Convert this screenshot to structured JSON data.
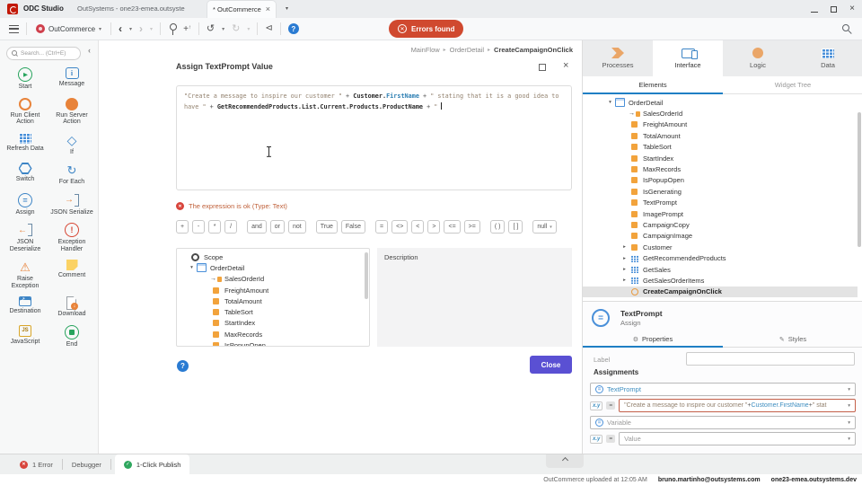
{
  "window": {
    "app_title": "ODC Studio",
    "tab_environment": "OutSystems - one23-emea.outsyste",
    "tab_module": "* OutCommerce"
  },
  "toolbar": {
    "module_name": "OutCommerce",
    "errors_badge": "Errors found"
  },
  "toolbox": {
    "search_placeholder": "Search... (Ctrl+E)",
    "items": [
      {
        "label": "Start",
        "icon": "ic-start",
        "name": "start-icon"
      },
      {
        "label": "Message",
        "icon": "ic-message",
        "name": "message-icon"
      },
      {
        "label": "Run Client Action",
        "icon": "ic-runclient",
        "name": "run-client-action-icon"
      },
      {
        "label": "Run Server Action",
        "icon": "ic-runserver",
        "name": "run-server-action-icon"
      },
      {
        "label": "Refresh Data",
        "icon": "ic-refresh grid-blue",
        "name": "refresh-data-icon"
      },
      {
        "label": "If",
        "icon": "ic-if",
        "name": "if-icon"
      },
      {
        "label": "Switch",
        "icon": "ic-switch",
        "name": "switch-icon"
      },
      {
        "label": "For Each",
        "icon": "ic-foreach",
        "name": "for-each-icon"
      },
      {
        "label": "Assign",
        "icon": "ic-assign",
        "name": "assign-icon"
      },
      {
        "label": "JSON Serialize",
        "icon": "ic-jser",
        "name": "json-serialize-icon"
      },
      {
        "label": "JSON Deserialize",
        "icon": "ic-jdeser",
        "name": "json-deserialize-icon"
      },
      {
        "label": "Exception Handler",
        "icon": "ic-exch",
        "name": "exception-handler-icon"
      },
      {
        "label": "Raise Exception",
        "icon": "ic-raise",
        "name": "raise-exception-icon"
      },
      {
        "label": "Comment",
        "icon": "ic-comment",
        "name": "comment-icon"
      },
      {
        "label": "Destination",
        "icon": "ic-dest",
        "name": "destination-icon"
      },
      {
        "label": "Download",
        "icon": "ic-down",
        "name": "download-icon"
      },
      {
        "label": "JavaScript",
        "icon": "ic-js",
        "name": "javascript-icon"
      },
      {
        "label": "End",
        "icon": "ic-end",
        "name": "end-icon"
      }
    ]
  },
  "canvas": {
    "breadcrumb": [
      "MainFlow",
      "OrderDetail",
      "CreateCampaignOnClick"
    ]
  },
  "dialog": {
    "title": "Assign TextPrompt Value",
    "expression": {
      "segments": [
        {
          "t": "\"Create a message to inspire our customer \"",
          "c": "sg-str"
        },
        {
          "t": " + ",
          "c": "sg-op"
        },
        {
          "t": "Customer.",
          "c": "sg-id"
        },
        {
          "t": "FirstName",
          "c": "sg-mem"
        },
        {
          "t": " + ",
          "c": "sg-op"
        },
        {
          "t": "\" stating that it is a good idea to have \"",
          "c": "sg-str"
        },
        {
          "t": " + ",
          "c": "sg-op"
        },
        {
          "t": "GetRecommendedProducts.List.Current.Products.ProductName",
          "c": "sg-id"
        },
        {
          "t": " + ",
          "c": "sg-op"
        },
        {
          "t": "\" ",
          "c": "sg-str"
        }
      ]
    },
    "status_text": "The expression is ok (Type: Text)",
    "operators": [
      {
        "label": "+"
      },
      {
        "label": "-"
      },
      {
        "label": "*"
      },
      {
        "label": "/"
      },
      {
        "label": "and",
        "cls": "gap"
      },
      {
        "label": "or"
      },
      {
        "label": "not"
      },
      {
        "label": "True",
        "cls": "gap"
      },
      {
        "label": "False"
      },
      {
        "label": "=",
        "cls": "gap"
      },
      {
        "label": "<>"
      },
      {
        "label": "<"
      },
      {
        "label": ">"
      },
      {
        "label": "<="
      },
      {
        "label": ">="
      },
      {
        "label": "( )",
        "cls": "gap"
      },
      {
        "label": "[ ]"
      },
      {
        "label": "null",
        "cls": "gap dd"
      }
    ],
    "scope": {
      "items": [
        {
          "label": "Scope",
          "icon": "scope-icon",
          "name": "scope-icon",
          "cls": "lvl0"
        },
        {
          "arrow": "▾",
          "label": "OrderDetail",
          "icon": "screen-icon",
          "name": "screen-icon",
          "cls": "lvl1"
        },
        {
          "label": "SalesOrderId",
          "icon": "input-icon",
          "name": "input-parameter-icon",
          "cls": "lvl2"
        },
        {
          "label": "FreightAmount",
          "icon": "var-icon",
          "name": "variable-icon",
          "cls": "lvl2"
        },
        {
          "label": "TotalAmount",
          "icon": "var-icon",
          "name": "variable-icon",
          "cls": "lvl2"
        },
        {
          "label": "TableSort",
          "icon": "var-icon",
          "name": "variable-icon",
          "cls": "lvl2"
        },
        {
          "label": "StartIndex",
          "icon": "var-icon",
          "name": "variable-icon",
          "cls": "lvl2"
        },
        {
          "label": "MaxRecords",
          "icon": "var-icon",
          "name": "variable-icon",
          "cls": "lvl2"
        },
        {
          "label": "IsPopupOpen",
          "icon": "var-icon",
          "name": "variable-icon",
          "cls": "lvl2"
        }
      ]
    },
    "description_title": "Description",
    "close_label": "Close"
  },
  "rightPanel": {
    "tabs": [
      {
        "label": "Processes"
      },
      {
        "label": "Interface"
      },
      {
        "label": "Logic"
      },
      {
        "label": "Data"
      }
    ],
    "subtabs": [
      "Elements",
      "Widget Tree"
    ],
    "tree": {
      "items": [
        {
          "arrow": "▾",
          "label": "OrderDetail",
          "icon": "screen-icon",
          "name": "screen-icon",
          "cls": "lvl1"
        },
        {
          "label": "SalesOrderId",
          "icon": "input-icon",
          "name": "input-parameter-icon",
          "cls": "lvl2"
        },
        {
          "label": "FreightAmount",
          "icon": "var-icon",
          "name": "variable-icon",
          "cls": "lvl2"
        },
        {
          "label": "TotalAmount",
          "icon": "var-icon",
          "name": "variable-icon",
          "cls": "lvl2"
        },
        {
          "label": "TableSort",
          "icon": "var-icon",
          "name": "variable-icon",
          "cls": "lvl2"
        },
        {
          "label": "StartIndex",
          "icon": "var-icon",
          "name": "variable-icon",
          "cls": "lvl2"
        },
        {
          "label": "MaxRecords",
          "icon": "var-icon",
          "name": "variable-icon",
          "cls": "lvl2"
        },
        {
          "label": "IsPopupOpen",
          "icon": "var-icon",
          "name": "variable-icon",
          "cls": "lvl2"
        },
        {
          "label": "IsGenerating",
          "icon": "var-icon",
          "name": "variable-icon",
          "cls": "lvl2"
        },
        {
          "label": "TextPrompt",
          "icon": "var-icon",
          "name": "variable-icon",
          "cls": "lvl2"
        },
        {
          "label": "ImagePrompt",
          "icon": "var-icon",
          "name": "variable-icon",
          "cls": "lvl2"
        },
        {
          "label": "CampaignCopy",
          "icon": "var-icon",
          "name": "variable-icon",
          "cls": "lvl2"
        },
        {
          "label": "CampaignImage",
          "icon": "var-icon",
          "name": "variable-icon",
          "cls": "lvl2"
        },
        {
          "arrow": "▸",
          "label": "Customer",
          "icon": "var-icon",
          "name": "variable-icon",
          "cls": "lvl2"
        },
        {
          "arrow": "▸",
          "label": "GetRecommendedProducts",
          "icon": "agg-icon",
          "name": "aggregate-icon",
          "cls": "lvl2"
        },
        {
          "arrow": "▸",
          "label": "GetSales",
          "icon": "agg-icon",
          "name": "aggregate-icon",
          "cls": "lvl2"
        },
        {
          "arrow": "▸",
          "label": "GetSalesOrderItems",
          "icon": "agg-icon",
          "name": "aggregate-icon",
          "cls": "lvl2"
        },
        {
          "label": "CreateCampaignOnClick",
          "icon": "action-icon",
          "name": "client-action-icon",
          "cls": "lvl2 sel bold"
        }
      ]
    },
    "properties": {
      "title": "TextPrompt",
      "subtitle": "Assign",
      "tab_properties": "Properties",
      "tab_styles": "Styles",
      "label_caption": "Label",
      "assignments_caption": "Assignments",
      "badge_xy": "x.y",
      "badge_eq": "=",
      "row_variable": "TextPrompt",
      "row_value_segments": [
        {
          "t": "\"Create a message to inspire our customer \"",
          "c": "sg-str"
        },
        {
          "t": " + ",
          "c": "sg-op"
        },
        {
          "t": "Customer.FirstName",
          "c": "sg-mem2"
        },
        {
          "t": " + ",
          "c": "sg-op"
        },
        {
          "t": "\" stat",
          "c": "sg-str"
        }
      ],
      "row_variable_placeholder": "Variable",
      "row_value_placeholder": "Value"
    }
  },
  "statusbar": {
    "error_tab": "1 Error",
    "debugger_tab": "Debugger",
    "publish_tab": "1-Click Publish",
    "upload_status": "OutCommerce uploaded at 12:05 AM",
    "user_email": "bruno.martinho@outsystems.com",
    "environment": "one23-emea.outsystems.dev"
  }
}
